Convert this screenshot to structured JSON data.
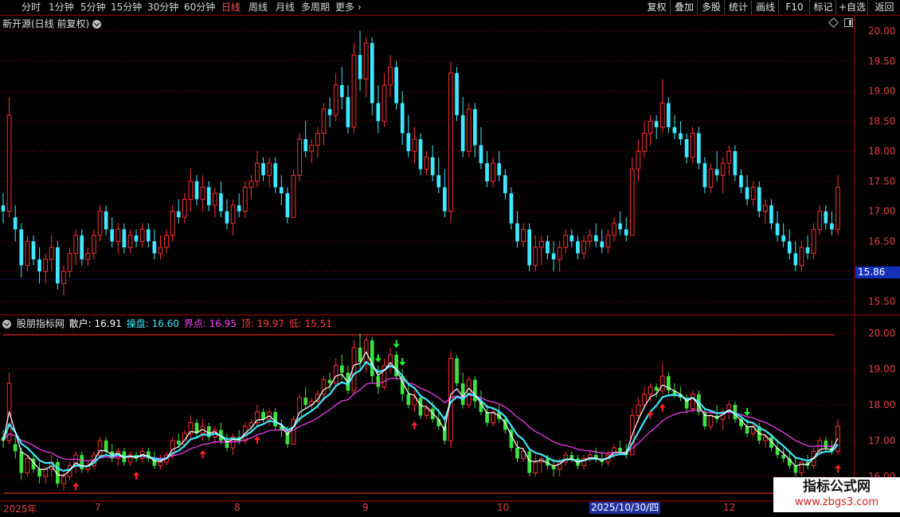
{
  "toolbar": {
    "periods": [
      "分时",
      "1分钟",
      "5分钟",
      "15分钟",
      "30分钟",
      "60分钟",
      "日线",
      "周线",
      "月线",
      "多周期",
      "更多"
    ],
    "active_period": "日线",
    "right_buttons": [
      "复权",
      "叠加",
      "多股",
      "统计",
      "画线",
      "F10",
      "标记",
      "+自选",
      "返回"
    ]
  },
  "main_chart": {
    "title": "新开源(日线 前复权)",
    "price_labels": [
      "20.00",
      "19.50",
      "19.00",
      "18.50",
      "18.00",
      "17.50",
      "17.00",
      "16.50",
      "16.00",
      "15.50"
    ],
    "current_price": "15.86"
  },
  "indicator": {
    "name": "股朋指标网",
    "items": [
      {
        "label": "散户: 16.91",
        "color": "#ffffff"
      },
      {
        "label": "操盘: 16.60",
        "color": "#40e8ff"
      },
      {
        "label": "界点: 16.95",
        "color": "#ff40ff"
      },
      {
        "label": "顶: 19.97",
        "color": "#ff4040"
      },
      {
        "label": "低: 15.51",
        "color": "#ff4040"
      }
    ],
    "price_labels": [
      "20.00",
      "19.00",
      "18.00",
      "17.00",
      "16.00"
    ]
  },
  "date_axis": {
    "labels": [
      "2025年",
      "7",
      "8",
      "9",
      "10",
      "12"
    ],
    "selected_date": "2025/10/30/四"
  },
  "watermark": {
    "line1": "指标公式网",
    "line2": "www.zbgs3.com"
  },
  "colors": {
    "up": "#ff3030",
    "down": "#40e8ff",
    "sub_down": "#40e040",
    "retail": "#ffffff",
    "operator": "#40e8ff",
    "boundary": "#ff40ff"
  },
  "chart_data": {
    "type": "candlestick",
    "x_start_label": "2025年",
    "ylim": [
      15.3,
      20.1
    ],
    "candles": [
      [
        17.1,
        17.3,
        16.8,
        17.0
      ],
      [
        17.0,
        18.9,
        16.9,
        18.6
      ],
      [
        16.9,
        17.1,
        16.5,
        16.7
      ],
      [
        16.7,
        16.8,
        15.9,
        16.1
      ],
      [
        16.1,
        16.6,
        16.0,
        16.5
      ],
      [
        16.5,
        16.6,
        16.1,
        16.2
      ],
      [
        16.2,
        16.4,
        15.8,
        16.0
      ],
      [
        16.0,
        16.3,
        15.8,
        16.2
      ],
      [
        16.2,
        16.6,
        16.0,
        16.4
      ],
      [
        16.4,
        16.5,
        15.7,
        15.8
      ],
      [
        15.8,
        16.1,
        15.6,
        16.0
      ],
      [
        16.0,
        16.4,
        15.9,
        16.3
      ],
      [
        16.3,
        16.7,
        16.1,
        16.6
      ],
      [
        16.6,
        16.7,
        16.1,
        16.2
      ],
      [
        16.2,
        16.4,
        16.1,
        16.3
      ],
      [
        16.3,
        16.7,
        16.2,
        16.6
      ],
      [
        16.6,
        17.1,
        16.5,
        17.0
      ],
      [
        17.0,
        17.1,
        16.6,
        16.7
      ],
      [
        16.7,
        16.9,
        16.4,
        16.5
      ],
      [
        16.5,
        16.8,
        16.3,
        16.7
      ],
      [
        16.7,
        16.8,
        16.3,
        16.4
      ],
      [
        16.4,
        16.7,
        16.3,
        16.6
      ],
      [
        16.6,
        16.7,
        16.4,
        16.5
      ],
      [
        16.5,
        16.8,
        16.4,
        16.7
      ],
      [
        16.7,
        16.8,
        16.4,
        16.5
      ],
      [
        16.5,
        16.7,
        16.2,
        16.3
      ],
      [
        16.3,
        16.6,
        16.2,
        16.4
      ],
      [
        16.4,
        16.7,
        16.3,
        16.6
      ],
      [
        16.6,
        17.1,
        16.5,
        17.0
      ],
      [
        17.0,
        17.2,
        16.8,
        16.9
      ],
      [
        16.9,
        17.3,
        16.8,
        17.2
      ],
      [
        17.2,
        17.7,
        17.0,
        17.5
      ],
      [
        17.5,
        17.6,
        17.1,
        17.2
      ],
      [
        17.2,
        17.6,
        17.0,
        17.4
      ],
      [
        17.4,
        17.5,
        17.0,
        17.1
      ],
      [
        17.1,
        17.4,
        16.9,
        17.3
      ],
      [
        17.3,
        17.5,
        16.9,
        17.0
      ],
      [
        17.0,
        17.2,
        16.7,
        16.8
      ],
      [
        16.8,
        17.2,
        16.6,
        17.1
      ],
      [
        17.1,
        17.3,
        16.9,
        17.0
      ],
      [
        17.0,
        17.5,
        16.9,
        17.4
      ],
      [
        17.4,
        17.6,
        17.2,
        17.5
      ],
      [
        17.5,
        18.0,
        17.4,
        17.8
      ],
      [
        17.8,
        17.9,
        17.5,
        17.6
      ],
      [
        17.6,
        17.9,
        17.4,
        17.8
      ],
      [
        17.8,
        17.9,
        17.3,
        17.4
      ],
      [
        17.4,
        17.6,
        17.1,
        17.3
      ],
      [
        17.3,
        17.4,
        16.8,
        16.9
      ],
      [
        16.9,
        17.7,
        16.9,
        17.6
      ],
      [
        17.6,
        18.3,
        17.5,
        18.2
      ],
      [
        18.2,
        18.5,
        17.9,
        18.0
      ],
      [
        18.0,
        18.2,
        17.8,
        18.1
      ],
      [
        18.1,
        18.4,
        17.9,
        18.3
      ],
      [
        18.3,
        18.8,
        18.1,
        18.7
      ],
      [
        18.7,
        18.9,
        18.4,
        18.6
      ],
      [
        18.6,
        19.3,
        18.5,
        19.1
      ],
      [
        19.1,
        19.4,
        18.7,
        18.9
      ],
      [
        18.9,
        19.1,
        18.3,
        18.4
      ],
      [
        18.4,
        19.8,
        18.3,
        19.6
      ],
      [
        19.6,
        20.0,
        19.0,
        19.2
      ],
      [
        19.2,
        19.9,
        18.9,
        19.8
      ],
      [
        19.8,
        19.9,
        18.6,
        18.8
      ],
      [
        18.8,
        19.1,
        18.3,
        18.5
      ],
      [
        18.5,
        19.3,
        18.4,
        19.1
      ],
      [
        19.1,
        19.6,
        18.9,
        19.4
      ],
      [
        19.4,
        19.5,
        18.7,
        18.8
      ],
      [
        18.8,
        19.0,
        18.1,
        18.3
      ],
      [
        18.3,
        18.6,
        17.9,
        18.0
      ],
      [
        18.0,
        18.4,
        17.8,
        18.2
      ],
      [
        18.2,
        18.3,
        17.6,
        17.7
      ],
      [
        17.7,
        18.0,
        17.6,
        17.9
      ],
      [
        17.9,
        18.1,
        17.5,
        17.6
      ],
      [
        17.6,
        17.9,
        17.3,
        17.4
      ],
      [
        17.4,
        17.7,
        16.9,
        17.0
      ],
      [
        17.0,
        19.5,
        16.8,
        19.3
      ],
      [
        19.3,
        19.4,
        18.5,
        18.6
      ],
      [
        18.6,
        18.9,
        17.9,
        18.0
      ],
      [
        18.0,
        18.8,
        17.9,
        18.7
      ],
      [
        18.7,
        18.8,
        17.9,
        18.1
      ],
      [
        18.1,
        18.4,
        17.7,
        17.8
      ],
      [
        17.8,
        18.0,
        17.4,
        17.5
      ],
      [
        17.5,
        17.9,
        17.4,
        17.8
      ],
      [
        17.8,
        18.0,
        17.5,
        17.6
      ],
      [
        17.6,
        17.7,
        17.2,
        17.3
      ],
      [
        17.3,
        17.4,
        16.7,
        16.8
      ],
      [
        16.8,
        17.0,
        16.4,
        16.5
      ],
      [
        16.5,
        16.8,
        16.4,
        16.7
      ],
      [
        16.7,
        16.8,
        16.0,
        16.1
      ],
      [
        16.1,
        16.6,
        16.0,
        16.4
      ],
      [
        16.4,
        16.6,
        16.1,
        16.5
      ],
      [
        16.5,
        16.6,
        16.2,
        16.3
      ],
      [
        16.3,
        16.5,
        16.0,
        16.2
      ],
      [
        16.2,
        16.5,
        16.0,
        16.4
      ],
      [
        16.4,
        16.7,
        16.3,
        16.6
      ],
      [
        16.6,
        16.7,
        16.4,
        16.5
      ],
      [
        16.5,
        16.6,
        16.2,
        16.3
      ],
      [
        16.3,
        16.6,
        16.2,
        16.5
      ],
      [
        16.5,
        16.7,
        16.4,
        16.6
      ],
      [
        16.6,
        16.8,
        16.4,
        16.5
      ],
      [
        16.5,
        16.7,
        16.3,
        16.4
      ],
      [
        16.4,
        16.7,
        16.3,
        16.6
      ],
      [
        16.6,
        16.9,
        16.5,
        16.8
      ],
      [
        16.8,
        17.0,
        16.6,
        16.7
      ],
      [
        16.7,
        16.9,
        16.5,
        16.6
      ],
      [
        16.6,
        17.9,
        16.6,
        17.7
      ],
      [
        17.7,
        18.2,
        17.5,
        18.0
      ],
      [
        18.0,
        18.5,
        17.9,
        18.3
      ],
      [
        18.3,
        18.6,
        18.1,
        18.5
      ],
      [
        18.5,
        18.6,
        18.2,
        18.4
      ],
      [
        18.4,
        19.2,
        18.3,
        18.8
      ],
      [
        18.8,
        18.9,
        18.3,
        18.4
      ],
      [
        18.4,
        18.6,
        18.2,
        18.3
      ],
      [
        18.3,
        18.5,
        18.1,
        18.2
      ],
      [
        18.2,
        18.3,
        17.8,
        17.9
      ],
      [
        17.9,
        18.4,
        17.8,
        18.3
      ],
      [
        18.3,
        18.4,
        17.7,
        17.8
      ],
      [
        17.8,
        17.9,
        17.3,
        17.4
      ],
      [
        17.4,
        17.8,
        17.3,
        17.7
      ],
      [
        17.7,
        18.0,
        17.5,
        17.6
      ],
      [
        17.6,
        17.9,
        17.3,
        17.8
      ],
      [
        17.8,
        18.1,
        17.6,
        18.0
      ],
      [
        18.0,
        18.1,
        17.5,
        17.6
      ],
      [
        17.6,
        17.7,
        17.3,
        17.4
      ],
      [
        17.4,
        17.6,
        17.1,
        17.2
      ],
      [
        17.2,
        17.5,
        17.1,
        17.4
      ],
      [
        17.4,
        17.5,
        16.9,
        17.0
      ],
      [
        17.0,
        17.2,
        16.8,
        17.1
      ],
      [
        17.1,
        17.2,
        16.7,
        16.8
      ],
      [
        16.8,
        17.0,
        16.5,
        16.6
      ],
      [
        16.6,
        16.8,
        16.4,
        16.5
      ],
      [
        16.5,
        16.7,
        16.2,
        16.3
      ],
      [
        16.3,
        16.5,
        16.0,
        16.1
      ],
      [
        16.1,
        16.5,
        16.0,
        16.4
      ],
      [
        16.4,
        16.6,
        16.2,
        16.3
      ],
      [
        16.3,
        16.8,
        16.2,
        16.7
      ],
      [
        16.7,
        17.1,
        16.6,
        17.0
      ],
      [
        17.0,
        17.1,
        16.7,
        16.8
      ],
      [
        16.8,
        17.0,
        16.6,
        16.7
      ],
      [
        16.7,
        17.6,
        16.6,
        17.4
      ]
    ],
    "series": [
      {
        "name": "散户",
        "color": "#ffffff"
      },
      {
        "name": "操盘",
        "color": "#40e8ff"
      },
      {
        "name": "界点",
        "color": "#ff40ff"
      }
    ],
    "buy_signals": [
      12,
      22,
      33,
      42,
      68,
      107,
      109,
      138
    ],
    "sell_signals": [
      62,
      65,
      66,
      123
    ]
  }
}
